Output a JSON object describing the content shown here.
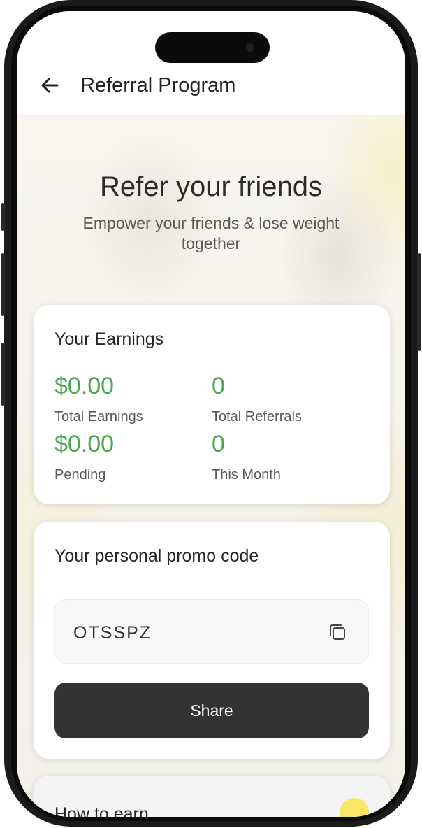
{
  "header": {
    "title": "Referral Program",
    "back_icon": "arrow-left-icon"
  },
  "hero": {
    "title": "Refer your friends",
    "subtitle": "Empower your friends & lose weight together"
  },
  "earnings": {
    "title": "Your Earnings",
    "total_earnings_value": "$0.00",
    "total_earnings_label": "Total Earnings",
    "total_referrals_value": "0",
    "total_referrals_label": "Total Referrals",
    "pending_value": "$0.00",
    "pending_label": "Pending",
    "this_month_value": "0",
    "this_month_label": "This Month"
  },
  "promo": {
    "title": "Your personal promo code",
    "code": "OTSSPZ",
    "copy_icon": "copy-icon",
    "share_label": "Share"
  },
  "how_to_earn": {
    "title": "How to earn"
  },
  "colors": {
    "accent_green": "#4ba84f",
    "button_dark": "#333333",
    "highlight_yellow": "#fbe24a"
  }
}
